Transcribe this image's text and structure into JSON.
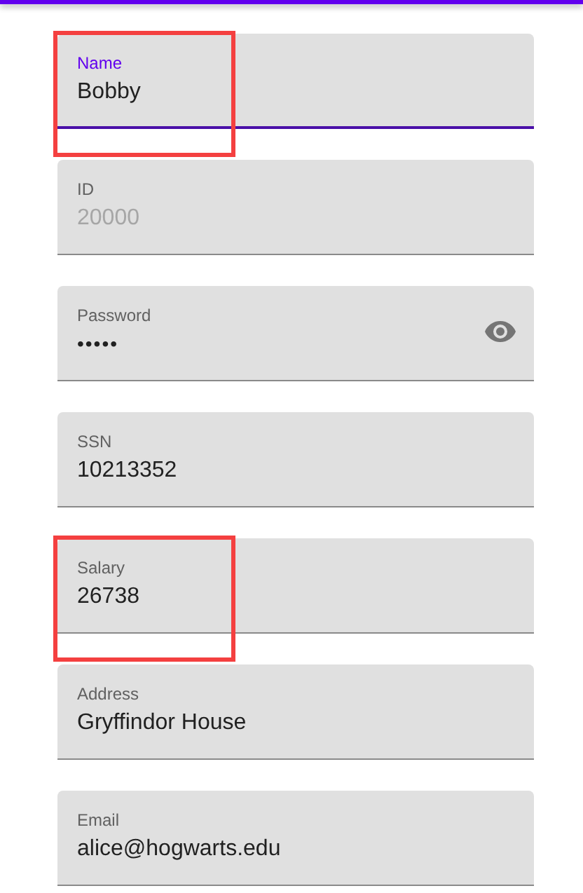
{
  "fields": [
    {
      "kind": "text",
      "label": "Name",
      "value": "Bobby",
      "focused": true,
      "highlighted": true
    },
    {
      "kind": "text",
      "label": "ID",
      "placeholder": "20000",
      "focused": false,
      "highlighted": false
    },
    {
      "kind": "password",
      "label": "Password",
      "value": "•••••",
      "focused": false,
      "highlighted": false
    },
    {
      "kind": "text",
      "label": "SSN",
      "value": "10213352",
      "focused": false,
      "highlighted": false
    },
    {
      "kind": "text",
      "label": "Salary",
      "value": "26738",
      "focused": false,
      "highlighted": true
    },
    {
      "kind": "text",
      "label": "Address",
      "value": "Gryffindor House",
      "focused": false,
      "highlighted": false
    },
    {
      "kind": "text",
      "label": "Email",
      "value": "alice@hogwarts.edu",
      "focused": false,
      "highlighted": false
    }
  ]
}
